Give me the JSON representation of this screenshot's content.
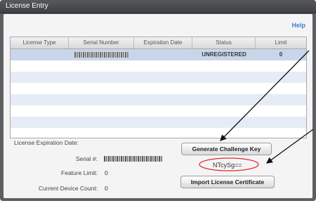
{
  "window": {
    "title": "License Entry"
  },
  "help_link": "Help",
  "table": {
    "columns": [
      "License Type",
      "Serial Number",
      "Expiration Date",
      "Status",
      "Limit"
    ],
    "rows": [
      {
        "license_type": "",
        "serial_number": "",
        "expiration_date": "",
        "status": "UNREGISTERED",
        "limit": "0"
      }
    ]
  },
  "details": {
    "expiration_label": "License Expiration Date:",
    "serial_label": "Serial #:",
    "feature_limit_label": "Feature Limit:",
    "feature_limit_value": "0",
    "device_count_label": "Current Device Count:",
    "device_count_value": "0"
  },
  "buttons": {
    "generate": "Generate Challenge Key",
    "import": "Import License Certificate"
  },
  "challenge_key": "NTcySg==",
  "colors": {
    "annotation": "#e8262a",
    "help": "#3c7fd6",
    "window": "#5d5f62"
  }
}
